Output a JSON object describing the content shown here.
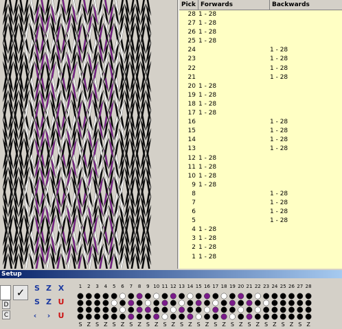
{
  "pick_table": {
    "headers": {
      "pick": "Pick",
      "forwards": "Forwards",
      "backwards": "Backwards"
    },
    "rows": [
      {
        "pick": "28",
        "forwards": "1 - 28",
        "backwards": ""
      },
      {
        "pick": "27",
        "forwards": "1 - 28",
        "backwards": ""
      },
      {
        "pick": "26",
        "forwards": "1 - 28",
        "backwards": ""
      },
      {
        "pick": "25",
        "forwards": "1 - 28",
        "backwards": ""
      },
      {
        "pick": "24",
        "forwards": "",
        "backwards": "1 - 28"
      },
      {
        "pick": "23",
        "forwards": "",
        "backwards": "1 - 28"
      },
      {
        "pick": "22",
        "forwards": "",
        "backwards": "1 - 28"
      },
      {
        "pick": "21",
        "forwards": "",
        "backwards": "1 - 28"
      },
      {
        "pick": "20",
        "forwards": "1 - 28",
        "backwards": ""
      },
      {
        "pick": "19",
        "forwards": "1 - 28",
        "backwards": ""
      },
      {
        "pick": "18",
        "forwards": "1 - 28",
        "backwards": ""
      },
      {
        "pick": "17",
        "forwards": "1 - 28",
        "backwards": ""
      },
      {
        "pick": "16",
        "forwards": "",
        "backwards": "1 - 28"
      },
      {
        "pick": "15",
        "forwards": "",
        "backwards": "1 - 28"
      },
      {
        "pick": "14",
        "forwards": "",
        "backwards": "1 - 28"
      },
      {
        "pick": "13",
        "forwards": "",
        "backwards": "1 - 28"
      },
      {
        "pick": "12",
        "forwards": "1 - 28",
        "backwards": ""
      },
      {
        "pick": "11",
        "forwards": "1 - 28",
        "backwards": ""
      },
      {
        "pick": "10",
        "forwards": "1 - 28",
        "backwards": ""
      },
      {
        "pick": "9",
        "forwards": "1 - 28",
        "backwards": ""
      },
      {
        "pick": "8",
        "forwards": "",
        "backwards": "1 - 28"
      },
      {
        "pick": "7",
        "forwards": "",
        "backwards": "1 - 28"
      },
      {
        "pick": "6",
        "forwards": "",
        "backwards": "1 - 28"
      },
      {
        "pick": "5",
        "forwards": "",
        "backwards": "1 - 28"
      },
      {
        "pick": "4",
        "forwards": "1 - 28",
        "backwards": ""
      },
      {
        "pick": "3",
        "forwards": "1 - 28",
        "backwards": ""
      },
      {
        "pick": "2",
        "forwards": "1 - 28",
        "backwards": ""
      },
      {
        "pick": "1",
        "forwards": "1 - 28",
        "backwards": ""
      }
    ]
  },
  "setup": {
    "title": "Setup",
    "buttons": {
      "check": "✓",
      "d_label": "D",
      "c_label": "C"
    },
    "tools": [
      {
        "name": "swap-s-icon",
        "glyph": "S",
        "color": "blue"
      },
      {
        "name": "swap-z-icon",
        "glyph": "Z",
        "color": "blue"
      },
      {
        "name": "swap-x-icon",
        "glyph": "X",
        "color": "blue"
      },
      {
        "name": "flip-s-icon",
        "glyph": "S",
        "color": "blue"
      },
      {
        "name": "flip-z-icon",
        "glyph": "Z",
        "color": "blue"
      },
      {
        "name": "turn-icon",
        "glyph": "U",
        "color": "red"
      },
      {
        "name": "rotate-left-icon",
        "glyph": "‹",
        "color": "blue"
      },
      {
        "name": "rotate-right-icon",
        "glyph": "›",
        "color": "blue"
      },
      {
        "name": "magnet-icon",
        "glyph": "U",
        "color": "red"
      }
    ],
    "card_numbers": [
      "1",
      "2",
      "3",
      "4",
      "5",
      "6",
      "7",
      "8",
      "9",
      "10",
      "11",
      "12",
      "13",
      "14",
      "15",
      "16",
      "17",
      "18",
      "19",
      "20",
      "21",
      "22",
      "23",
      "24",
      "25",
      "26",
      "27",
      "28"
    ],
    "threading": [
      "S",
      "Z",
      "S",
      "Z",
      "S",
      "Z",
      "S",
      "Z",
      "S",
      "Z",
      "S",
      "Z",
      "S",
      "Z",
      "S",
      "Z",
      "S",
      "Z",
      "S",
      "Z",
      "S",
      "Z",
      "S",
      "Z",
      "S",
      "Z",
      "S",
      "Z"
    ],
    "hole_colors": {
      "k": "#000000",
      "w": "#ffffff",
      "p": "#7a1a8a"
    },
    "card_holes": [
      [
        "k",
        "k",
        "k",
        "k"
      ],
      [
        "k",
        "k",
        "k",
        "k"
      ],
      [
        "k",
        "k",
        "k",
        "k"
      ],
      [
        "k",
        "k",
        "k",
        "k"
      ],
      [
        "k",
        "w",
        "k",
        "k"
      ],
      [
        "w",
        "k",
        "w",
        "k"
      ],
      [
        "k",
        "p",
        "k",
        "p"
      ],
      [
        "p",
        "k",
        "p",
        "k"
      ],
      [
        "k",
        "w",
        "p",
        "k"
      ],
      [
        "w",
        "k",
        "k",
        "p"
      ],
      [
        "k",
        "p",
        "k",
        "w"
      ],
      [
        "p",
        "k",
        "w",
        "k"
      ],
      [
        "k",
        "w",
        "p",
        "k"
      ],
      [
        "w",
        "k",
        "k",
        "p"
      ],
      [
        "k",
        "p",
        "k",
        "w"
      ],
      [
        "p",
        "k",
        "w",
        "k"
      ],
      [
        "k",
        "w",
        "p",
        "k"
      ],
      [
        "w",
        "k",
        "k",
        "p"
      ],
      [
        "k",
        "p",
        "k",
        "w"
      ],
      [
        "p",
        "k",
        "w",
        "k"
      ],
      [
        "k",
        "p",
        "k",
        "p"
      ],
      [
        "w",
        "k",
        "w",
        "k"
      ],
      [
        "k",
        "w",
        "k",
        "k"
      ],
      [
        "k",
        "k",
        "k",
        "k"
      ],
      [
        "k",
        "k",
        "k",
        "k"
      ],
      [
        "k",
        "k",
        "k",
        "k"
      ],
      [
        "k",
        "k",
        "k",
        "k"
      ],
      [
        "k",
        "k",
        "k",
        "k"
      ]
    ]
  },
  "colors": {
    "yarn_black": "#000000",
    "yarn_white": "#ffffff",
    "yarn_purple": "#7a1a8a",
    "table_bg": "#ffffc4"
  }
}
